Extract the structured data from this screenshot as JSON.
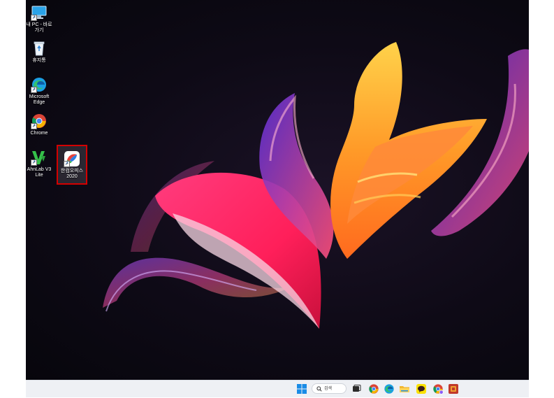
{
  "desktop": {
    "icons": [
      {
        "label": "내 PC - 바로\n가기",
        "icon": "monitor-icon"
      },
      {
        "label": "휴지통",
        "icon": "recycle-bin-icon"
      },
      {
        "label": "Microsoft\nEdge",
        "icon": "edge-icon"
      },
      {
        "label": "Chrome",
        "icon": "chrome-icon"
      },
      {
        "label": "AhnLab V3\nLite",
        "icon": "ahnlab-v3-icon"
      },
      {
        "label": "한컴오피스\n2020",
        "icon": "hancom-office-icon",
        "selected": true,
        "highlight_color": "#d40000"
      }
    ]
  },
  "taskbar": {
    "search_placeholder": "검색",
    "items": [
      "start-icon",
      "search",
      "task-view-icon",
      "chrome-icon",
      "edge-icon",
      "file-explorer-icon",
      "kakaotalk-icon",
      "chrome-profile-icon",
      "hancom-icon"
    ]
  },
  "colors": {
    "accent": "#d40000",
    "taskbar_bg": "#eef0f4",
    "desktop_bg": "#0e0a16"
  }
}
